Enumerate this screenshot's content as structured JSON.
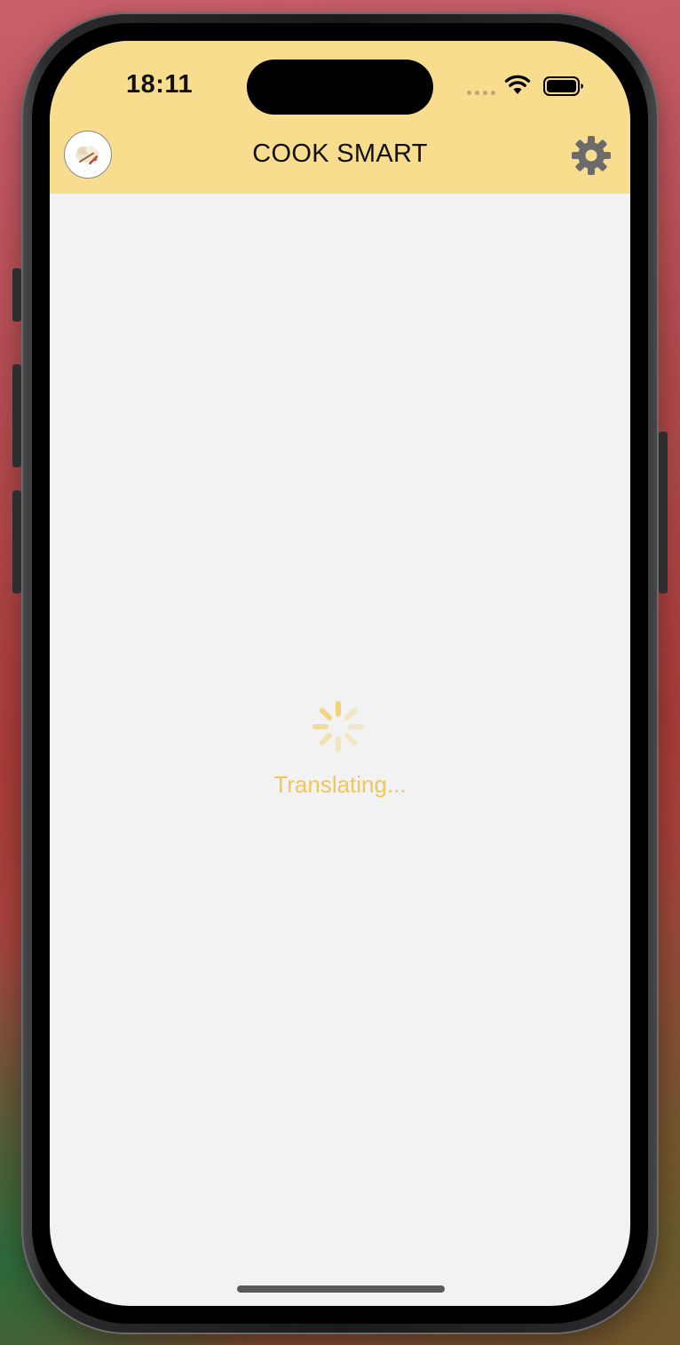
{
  "status_bar": {
    "time": "18:11",
    "wifi_icon": "wifi-icon",
    "battery_icon": "battery-icon"
  },
  "header": {
    "title": "COOK SMART",
    "logo_icon": "chef-hat-logo",
    "settings_icon": "gear-icon",
    "background": "#f8dd8f"
  },
  "main": {
    "loading_text": "Translating...",
    "accent": "#f2c65a",
    "background": "#f2f2f2"
  }
}
